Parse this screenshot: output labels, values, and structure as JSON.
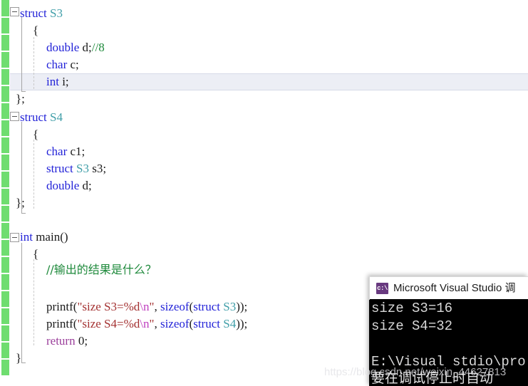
{
  "editor": {
    "language": "C",
    "current_line_index": 3,
    "change_bar_color": "#6fdd70",
    "background": "#ffffff",
    "token_colors": {
      "keyword": "#2323d8",
      "user_type": "#3f9ea8",
      "control": "#9b3f9b",
      "comment": "#1f8a3c",
      "string": "#a33030",
      "escape": "#c040c0",
      "plain": "#1a1a1a"
    },
    "lines": [
      {
        "indent": 0,
        "text": "struct S3"
      },
      {
        "indent": 1,
        "text": "{"
      },
      {
        "indent": 2,
        "text": "double d;//8"
      },
      {
        "indent": 2,
        "text": "char c;"
      },
      {
        "indent": 2,
        "text": "int i;"
      },
      {
        "indent": 1,
        "text": "};"
      },
      {
        "indent": 0,
        "text": "struct S4"
      },
      {
        "indent": 1,
        "text": "{"
      },
      {
        "indent": 2,
        "text": "char c1;"
      },
      {
        "indent": 2,
        "text": "struct S3 s3;"
      },
      {
        "indent": 2,
        "text": "double d;"
      },
      {
        "indent": 1,
        "text": "};"
      },
      {
        "indent": 0,
        "text": ""
      },
      {
        "indent": 0,
        "text": "int main()"
      },
      {
        "indent": 1,
        "text": "{"
      },
      {
        "indent": 2,
        "text": "//输出的结果是什么？"
      },
      {
        "indent": 2,
        "text": ""
      },
      {
        "indent": 2,
        "text": "printf(\"size S3=%d\\n\", sizeof(struct S3));"
      },
      {
        "indent": 2,
        "text": "printf(\"size S4=%d\\n\", sizeof(struct S4));"
      },
      {
        "indent": 2,
        "text": "return 0;"
      },
      {
        "indent": 1,
        "text": "}"
      }
    ],
    "code_tokens": {
      "l1_kw": "struct",
      "l1_type": "S3",
      "l2": "{",
      "l3_kw": "double",
      "l3_plain": " d;",
      "l3_cmt": "//8",
      "l4_kw": "char",
      "l4_plain": " c;",
      "l5_kw": "int",
      "l5_plain": " i;",
      "l6": "};",
      "l7_kw": "struct",
      "l7_type": "S4",
      "l8": "{",
      "l9_kw": "char",
      "l9_plain": " c1;",
      "l10_kw": "struct",
      "l10_type": "S3",
      "l10_plain": " s3;",
      "l11_kw": "double",
      "l11_plain": " d;",
      "l12": "};",
      "l14_kw": "int",
      "l14_plain": " main()",
      "l15": "{",
      "l16_cmt": "//输出的结果是什么？",
      "l18_fn": "printf(",
      "l18_str": "\"size S3=%d",
      "l18_esc": "\\n",
      "l18_str2": "\"",
      "l18_sep": ", ",
      "l18_kw1": "sizeof",
      "l18_p1": "(",
      "l18_kw2": "struct",
      "l18_type": " S3",
      "l18_end": "));",
      "l19_fn": "printf(",
      "l19_str": "\"size S4=%d",
      "l19_esc": "\\n",
      "l19_str2": "\"",
      "l19_sep": ", ",
      "l19_kw1": "sizeof",
      "l19_p1": "(",
      "l19_kw2": "struct",
      "l19_type": " S4",
      "l19_end": "));",
      "l20_ctl": "return",
      "l20_num": " 0;",
      "l21": "}"
    }
  },
  "console": {
    "title": "Microsoft Visual Studio 调",
    "icon": "console-app-icon",
    "icon_label": "c:\\",
    "output_lines": [
      "size S3=16",
      "size S4=32",
      "",
      "E:\\Visual stdio\\pro",
      "要在调试停止时自动"
    ]
  },
  "watermark": {
    "text": "https://blog.csdn.net/weixin_44627813"
  }
}
